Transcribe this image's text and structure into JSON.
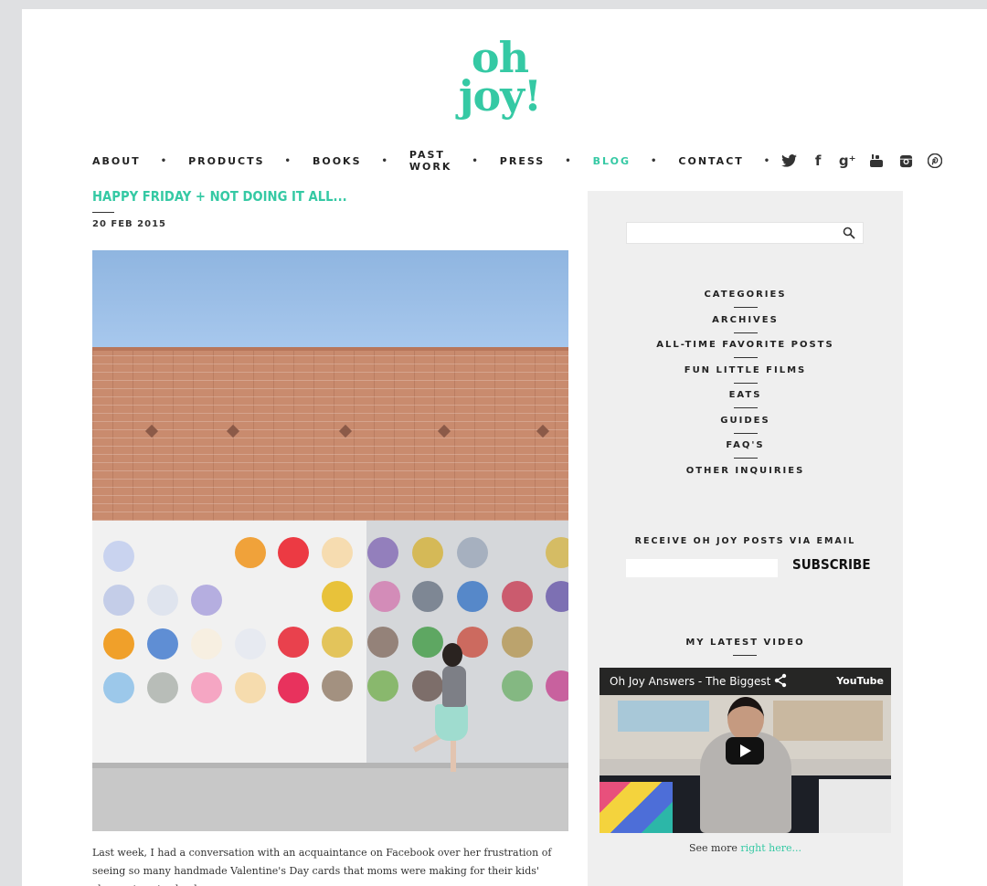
{
  "logo": {
    "line1": "oh",
    "line2": "joy!"
  },
  "nav": {
    "items": [
      "ABOUT",
      "PRODUCTS",
      "BOOKS",
      "PAST WORK",
      "PRESS",
      "BLOG",
      "CONTACT"
    ],
    "separator": "•",
    "active": "BLOG"
  },
  "social": {
    "icons": [
      "twitter-icon",
      "facebook-icon",
      "google-plus-icon",
      "youtube-icon",
      "instagram-icon",
      "pinterest-icon"
    ],
    "glyphs": {
      "facebook": "f",
      "google_plus": "g⁺"
    }
  },
  "post": {
    "title": "HAPPY FRIDAY + NOT DOING IT ALL...",
    "date": "20 FEB 2015",
    "body": "Last week, I had a conversation with an acquaintance on Facebook over her frustration of seeing so many handmade Valentine's Day cards that moms were making for their kids' classmates at school."
  },
  "sidebar": {
    "search_placeholder": "",
    "categories": [
      "CATEGORIES",
      "ARCHIVES",
      "ALL-TIME FAVORITE POSTS",
      "FUN LITTLE FILMS",
      "EATS",
      "GUIDES",
      "FAQ'S",
      "OTHER INQUIRIES"
    ],
    "email_label": "RECEIVE OH JOY POSTS VIA EMAIL",
    "subscribe_label": "SUBSCRIBE",
    "video_label": "MY LATEST VIDEO",
    "video_title": "Oh Joy Answers - The Biggest",
    "video_brand": "YouTube",
    "see_more_prefix": "See more ",
    "see_more_link": "right here..."
  },
  "colors": {
    "accent": "#35c9a4",
    "background": "#dfe0e2",
    "sidebar": "#efefef"
  }
}
